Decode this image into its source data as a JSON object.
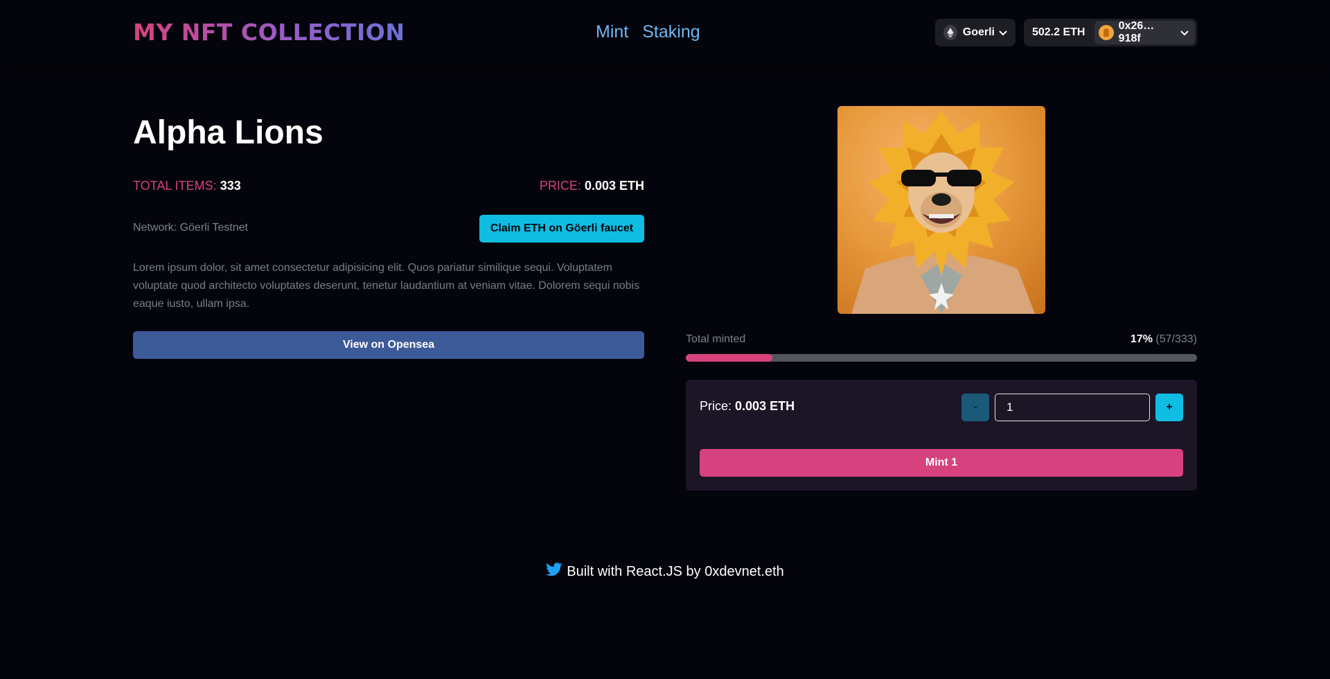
{
  "header": {
    "logo": "MY NFT COLLECTION",
    "nav": [
      "Mint",
      "Staking"
    ],
    "network": "Goerli",
    "balance": "502.2 ETH",
    "address": "0x26…918f"
  },
  "main": {
    "title": "Alpha Lions",
    "total_items_label": "TOTAL ITEMS:",
    "total_items": "333",
    "price_label": "PRICE:",
    "price": "0.003 ETH",
    "network": "Network: Göerli Testnet",
    "faucet_button": "Claim ETH on Göerli faucet",
    "description": "Lorem ipsum dolor, sit amet consectetur adipisicing elit. Quos pariatur similique sequi. Voluptatem voluptate quod architecto voluptates deserunt, tenetur laudantium at veniam vitae. Dolorem sequi nobis eaque iusto, ullam ipsa.",
    "opensea_button": "View on Opensea"
  },
  "mint": {
    "minted_label": "Total minted",
    "minted_percent": "17%",
    "minted_count": "(57/333)",
    "progress_fraction": 0.17,
    "price_label": "Price:",
    "price": "0.003 ETH",
    "minus": "-",
    "plus": "+",
    "quantity": "1",
    "mint_button": "Mint 1"
  },
  "footer": {
    "text": "Built with React.JS by 0xdevnet.eth"
  },
  "colors": {
    "accent_pink": "#d6427d",
    "accent_cyan": "#0fbde3",
    "opensea_blue": "#3c5998",
    "background": "#04040c"
  },
  "icons": [
    "ethereum-icon",
    "chevron-down-icon",
    "avatar-icon",
    "twitter-icon"
  ]
}
